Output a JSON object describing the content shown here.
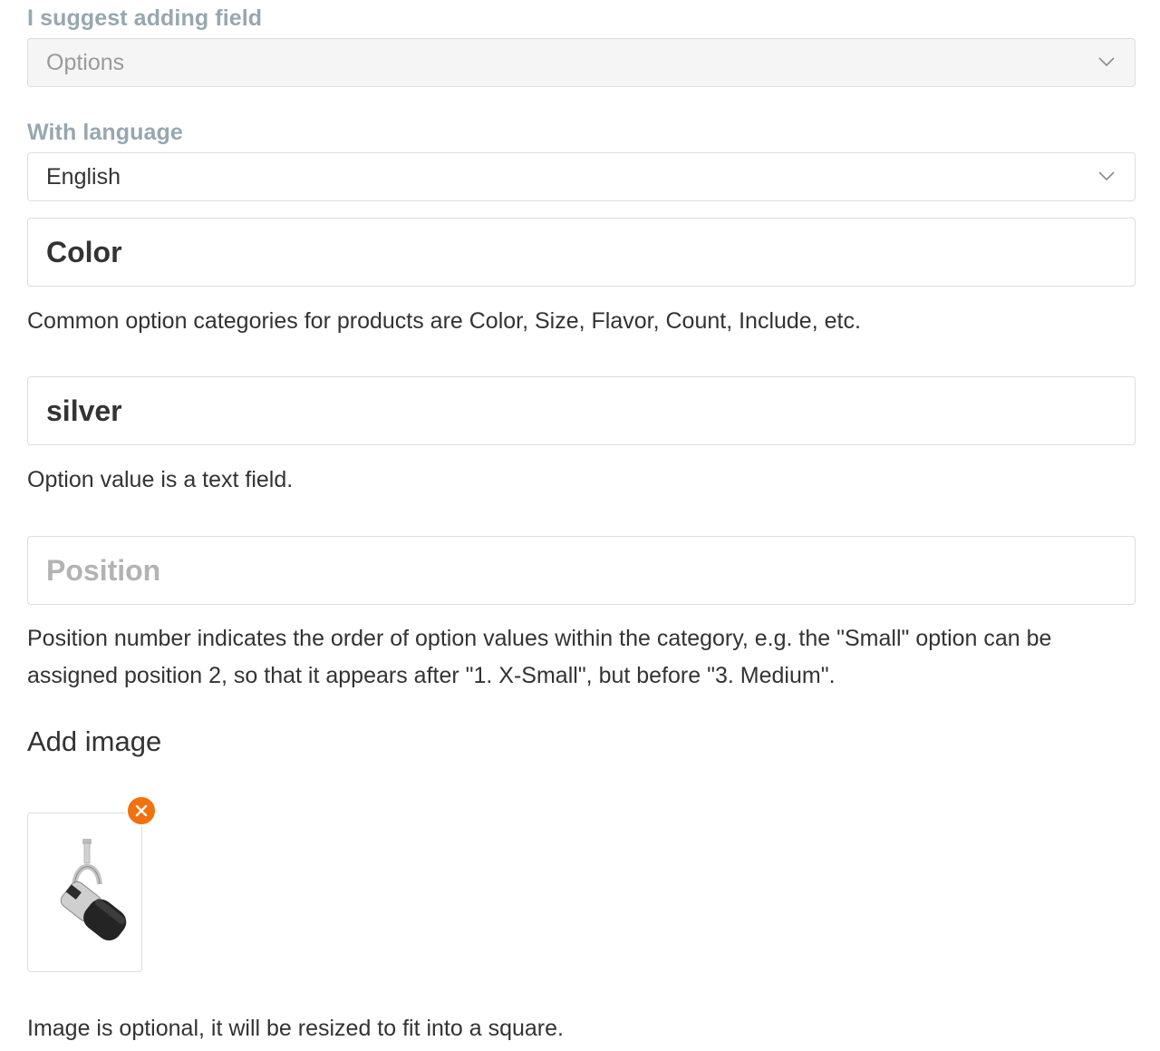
{
  "suggest": {
    "label": "I suggest adding field",
    "selected": "Options",
    "chevron_icon": "chevron-down-icon"
  },
  "language": {
    "label": "With language",
    "selected": "English",
    "chevron_icon": "chevron-down-icon"
  },
  "category": {
    "value": "Color",
    "help": "Common option categories for products are Color, Size, Flavor, Count, Include, etc."
  },
  "option_value": {
    "value": "silver",
    "help": "Option value is a text field."
  },
  "position": {
    "placeholder": "Position",
    "help": "Position number indicates the order of option values within the category, e.g. the \"Small\" option can be assigned position 2, so that it appears after \"1. X-Small\", but before \"3. Medium\"."
  },
  "image": {
    "title": "Add image",
    "remove_icon": "close-icon",
    "remove_color": "#f2700e",
    "help": "Image is optional, it will be resized to fit into a square."
  }
}
